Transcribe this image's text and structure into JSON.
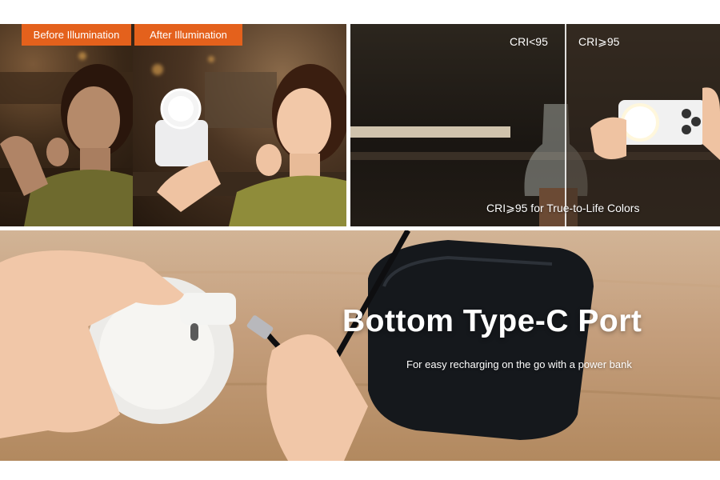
{
  "panel_before_after": {
    "before_label": "Before Illumination",
    "after_label": "After Illumination",
    "accent_color": "#e4611c"
  },
  "panel_cri": {
    "low_label": "CRI<95",
    "high_label": "CRI⩾95",
    "caption": "CRI⩾95 for True-to-Life Colors"
  },
  "panel_port": {
    "headline": "Bottom Type-C Port",
    "subline": "For easy recharging on the go with a power bank"
  }
}
